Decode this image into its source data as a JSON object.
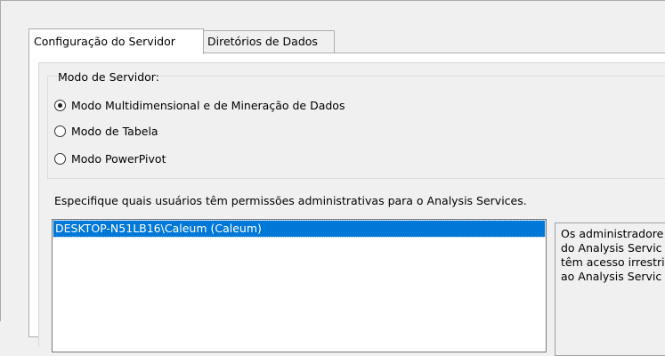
{
  "tabs": [
    {
      "label": "Configuração do Servidor",
      "active": true
    },
    {
      "label": "Diretórios de Dados",
      "active": false
    }
  ],
  "server_mode": {
    "group_label": "Modo de Servidor:",
    "options": [
      {
        "label": "Modo Multidimensional e de Mineração de Dados",
        "selected": true
      },
      {
        "label": "Modo de Tabela",
        "selected": false
      },
      {
        "label": "Modo PowerPivot",
        "selected": false
      }
    ]
  },
  "admins": {
    "description": "Especifique quais usuários têm permissões administrativas para o Analysis Services.",
    "users": [
      "DESKTOP-N51LB16\\Caleum (Caleum)"
    ],
    "info_lines": [
      "Os administradore",
      "do Analysis Servic",
      "têm acesso irrestri",
      "ao Analysis Servic"
    ]
  },
  "colors": {
    "selection": "#0078d7",
    "window_bg": "#f0f0f0"
  }
}
